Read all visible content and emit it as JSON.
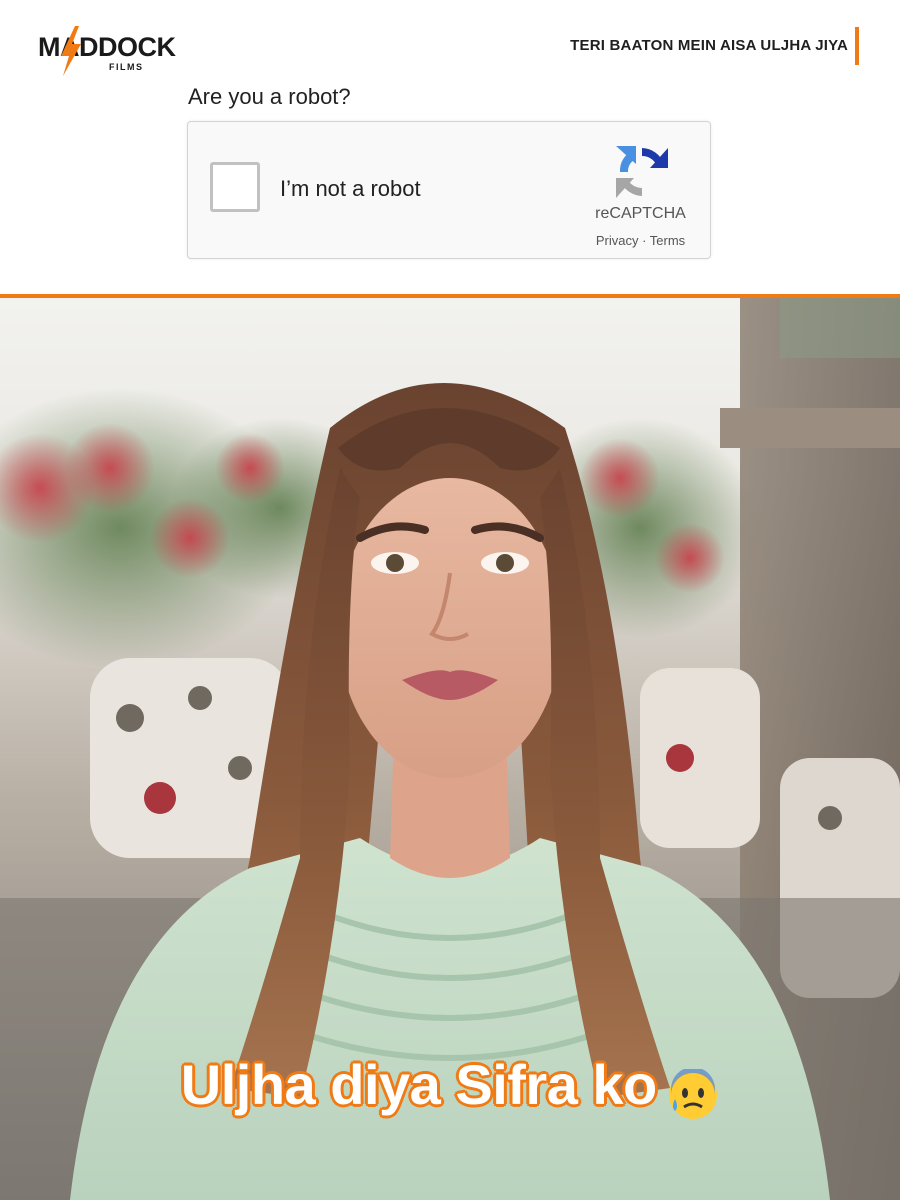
{
  "header": {
    "logo_main": "MADDOCK",
    "logo_sub": "FILMS",
    "tagline": "TERI BAATON MEIN AISA ULJHA JIYA"
  },
  "captcha": {
    "question": "Are you a robot?",
    "checkbox_label": "I’m not a robot",
    "brand": "reCAPTCHA",
    "privacy": "Privacy",
    "separator": " · ",
    "terms": "Terms"
  },
  "caption": {
    "text": "Uljha diya Sifra ko",
    "emoji": "anxious-face-with-sweat-icon"
  },
  "colors": {
    "accent": "#f07a14",
    "recaptcha_blue": "#1c3aa9",
    "recaptcha_lightblue": "#4a90e2",
    "recaptcha_gray": "#a6a6a6"
  }
}
